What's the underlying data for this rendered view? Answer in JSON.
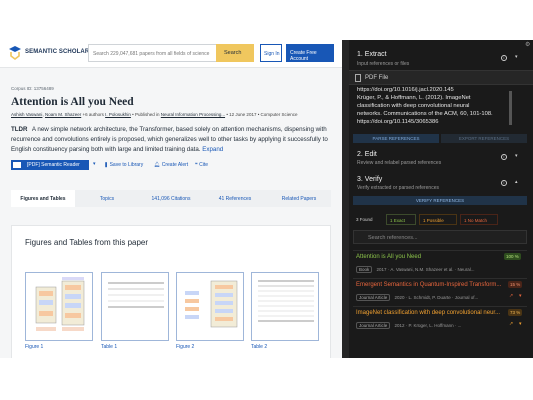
{
  "site": {
    "brand": "SEMANTIC SCHOLAR",
    "search_placeholder": "Search 229,047,681 papers from all fields of science",
    "search_button": "Search",
    "sign_in": "Sign In",
    "create_account": "Create Free Account"
  },
  "paper": {
    "corpus_id": "Corpus ID: 13756489",
    "title": "Attention is All you Need",
    "authors": [
      "Ashish Vaswani",
      "Noam M. Shazeer"
    ],
    "more_authors": "+6 authors",
    "last_author": "I. Polosukhin",
    "published_prefix": "Published in",
    "venue": "Neural Information Processing...",
    "date": "12 June 2017",
    "field": "Computer Science",
    "tldr_tag": "TLDR",
    "tldr": "A new simple network architecture, the Transformer, based solely on attention mechanisms, dispensing with recurrence and convolutions entirely is proposed, which generalizes well to other tasks by applying it successfully to English constituency parsing both with large and limited training data.",
    "expand": "Expand"
  },
  "actions": {
    "reader": "[PDF] Semantic Reader",
    "save": "Save to Library",
    "alert": "Create Alert",
    "cite": "Cite"
  },
  "tabs": [
    "Figures and Tables",
    "Topics",
    "141,096 Citations",
    "41 References",
    "Related Papers"
  ],
  "figures": {
    "heading": "Figures and Tables from this paper",
    "captions": [
      "Figure 1",
      "Table 1",
      "Figure 2",
      "Table 2"
    ]
  },
  "panel": {
    "step1_title": "1. Extract",
    "step1_sub": "Input references or files",
    "pdf_label": "PDF File",
    "ref_lines": [
      "https://doi.org/10.1016/j.jacl.2020.145",
      "Krüger, P., & Hoffmann, L. (2012). ImageNet",
      "classification with deep convolutional neural",
      "networks. Communications of the ACM, 60, 101-108.",
      "https://doi.org/10.1145/3065386"
    ],
    "parse_button": "PARSE REFERENCES",
    "export_button": "EXPORT REFERENCES",
    "step2_title": "2. Edit",
    "step2_sub": "Review and relabel parsed references",
    "step3_title": "3. Verify",
    "step3_sub": "Verify extracted or parsed references",
    "verify_button": "VERIFY REFERENCES",
    "filters": [
      "3 Found",
      "1 Exact",
      "1 Possible",
      "1 No Match"
    ],
    "search_placeholder": "Search references...",
    "results": [
      {
        "title": "Attention is All you Need",
        "score": "100 %",
        "type": "Book",
        "year": "2017",
        "authors": "A. Vaswani, N.M. Shazeer et al.",
        "venue": "Neural...",
        "color": "#8bc34a",
        "badge_bg": "#2e4d1e",
        "badge_fg": "#b5e07d"
      },
      {
        "title": "Emergent Semantics in Quantum-Inspired Transform...",
        "score": "15 %",
        "type": "Journal Article",
        "year": "2020",
        "authors": "L. Schmidt, P. Duarte",
        "venue": "Journal of...",
        "color": "#e8663d",
        "badge_bg": "#4a2418",
        "badge_fg": "#f2936f"
      },
      {
        "title": "ImageNet classification with deep convolutional neur...",
        "score": "73 %",
        "type": "Journal Article",
        "year": "2012",
        "authors": "P. Krüger, L. Hoffmann",
        "venue": "...",
        "color": "#f0a030",
        "badge_bg": "#4a3414",
        "badge_fg": "#f5b955"
      }
    ]
  },
  "colors": {
    "brand_blue": "#1857b6",
    "search_yellow": "#f0c75e",
    "panel_bg": "#1a1a1a",
    "accent_blue": "#8fb6e3"
  }
}
